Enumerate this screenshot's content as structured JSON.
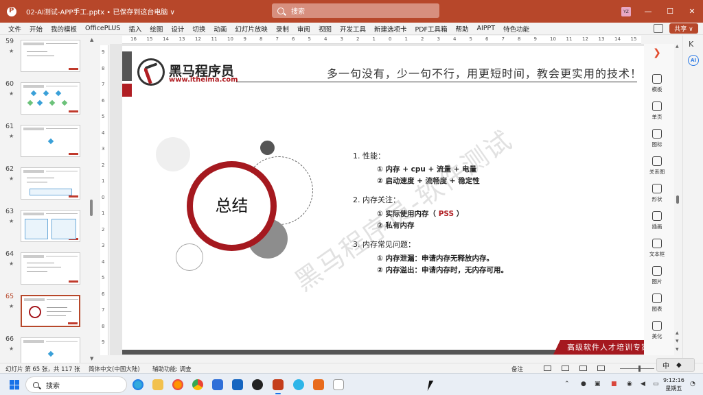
{
  "window": {
    "title": "02-AI测试-APP手工.pptx • 已保存到这台电脑 ∨",
    "search_placeholder": "搜索",
    "avatar_initials": "YZ",
    "buttons": {
      "minimize": "—",
      "maximize": "☐",
      "close": "✕"
    }
  },
  "ribbon": {
    "tabs": [
      "文件",
      "开始",
      "我的模板",
      "OfficePLUS",
      "插入",
      "绘图",
      "设计",
      "切换",
      "动画",
      "幻灯片放映",
      "录制",
      "审阅",
      "视图",
      "开发工具",
      "新建选项卡",
      "PDF工具箱",
      "帮助",
      "AIPPT",
      "特色功能"
    ],
    "share_label": "共享 ∨"
  },
  "thumbnails": [
    {
      "number": "59",
      "star": "★",
      "layout": "text"
    },
    {
      "number": "60",
      "star": "★",
      "layout": "diamonds"
    },
    {
      "number": "61",
      "star": "★",
      "layout": "single-diamond"
    },
    {
      "number": "62",
      "star": "★",
      "layout": "table"
    },
    {
      "number": "63",
      "star": "★",
      "layout": "boxes"
    },
    {
      "number": "64",
      "star": "★",
      "layout": "list"
    },
    {
      "number": "65",
      "star": "★",
      "layout": "summary",
      "active": true
    },
    {
      "number": "66",
      "star": "★",
      "layout": "single-diamond"
    }
  ],
  "ruler": {
    "top": [
      "16",
      "15",
      "14",
      "13",
      "12",
      "11",
      "10",
      "9",
      "8",
      "7",
      "6",
      "5",
      "4",
      "3",
      "2",
      "1",
      "0",
      "1",
      "2",
      "3",
      "4",
      "5",
      "6",
      "7",
      "8",
      "9",
      "10",
      "11",
      "12",
      "13",
      "14",
      "15",
      "16"
    ],
    "left": [
      "9",
      "8",
      "7",
      "6",
      "5",
      "4",
      "3",
      "2",
      "1",
      "0",
      "1",
      "2",
      "3",
      "4",
      "5",
      "6",
      "7",
      "8",
      "9"
    ]
  },
  "slide": {
    "brand_name": "黑马程序员",
    "brand_url": "www.itheima.com",
    "slogan": "多一句没有，少一句不行，用更短时间，教会更实用的技术！",
    "title": "总结",
    "watermark": "黑马程序员-软件测试",
    "sections": [
      {
        "heading": "1.  性能：",
        "items": [
          "①  内存 + cpu + 流量 + 电量",
          "②  启动速度 + 流畅度 + 稳定性"
        ]
      },
      {
        "heading": "2.  内存关注：",
        "items": [
          "①  实际使用内存（ PSS ）",
          "②  私有内存"
        ]
      },
      {
        "heading": "3.  内存常见问题：",
        "items": [
          "①  内存泄漏：申请内存无释放内存。",
          "②  内存溢出：申请内存时，无内存可用。"
        ]
      }
    ],
    "footer_tag": "高级软件人才培训专家"
  },
  "tools": [
    {
      "label": "",
      "icon": "designer-star-icon"
    },
    {
      "label": "模板",
      "icon": "template-icon"
    },
    {
      "label": "单页",
      "icon": "single-page-icon"
    },
    {
      "label": "图标",
      "icon": "icons-icon"
    },
    {
      "label": "关系图",
      "icon": "relation-diagram-icon"
    },
    {
      "label": "形状",
      "icon": "shapes-icon"
    },
    {
      "label": "插画",
      "icon": "illustration-icon"
    },
    {
      "label": "文本框",
      "icon": "textbox-icon"
    },
    {
      "label": "图片",
      "icon": "picture-icon"
    },
    {
      "label": "图表",
      "icon": "chart-icon"
    },
    {
      "label": "美化",
      "icon": "beautify-icon"
    }
  ],
  "far_right": {
    "collapse": "K",
    "ai_label": "AI"
  },
  "statusbar": {
    "slide_count": "幻灯片 第 65 张，共 117 张",
    "language": "简体中文(中国大陆)",
    "accessibility": "辅助功能: 调查",
    "notes": "备注"
  },
  "ime": {
    "mode": "中"
  },
  "taskbar": {
    "search_placeholder": "搜索",
    "time": "9:12:16",
    "weekday": "星期五"
  },
  "colors": {
    "accent": "#b7472a",
    "brand_red": "#a5191f",
    "slide_gray": "#555555"
  }
}
